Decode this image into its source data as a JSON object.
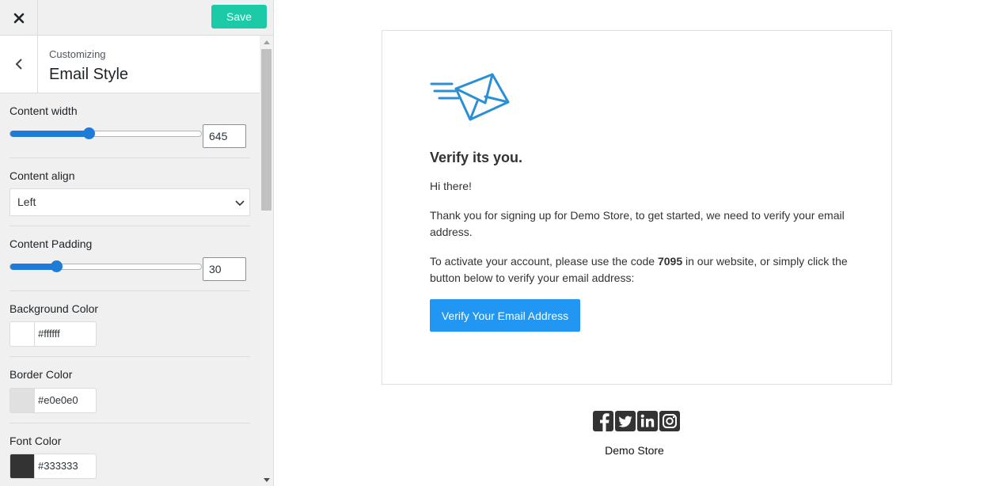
{
  "topbar": {
    "close_icon": "close-icon",
    "save_label": "Save",
    "save_color": "#1ccaa8"
  },
  "section": {
    "crumb": "Customizing",
    "title": "Email Style",
    "back_icon": "chevron-left-icon"
  },
  "controls": {
    "content_width": {
      "label": "Content width",
      "value": "645",
      "fraction": 0.41
    },
    "content_align": {
      "label": "Content align",
      "value": "Left"
    },
    "content_padding": {
      "label": "Content Padding",
      "value": "30",
      "fraction": 0.24
    },
    "background_color": {
      "label": "Background Color",
      "value": "#ffffff"
    },
    "border_color": {
      "label": "Border Color",
      "value": "#e0e0e0"
    },
    "font_color": {
      "label": "Font Color",
      "value": "#333333"
    }
  },
  "email": {
    "icon": "mail-fast-icon",
    "heading": "Verify its you.",
    "greeting": "Hi there!",
    "para1": "Thank you for signing up for Demo Store, to get started, we need to verify your email address.",
    "para2_before": "To activate your account, please use the code ",
    "code": "7095",
    "para2_after": " in our website, or simply click the button below to verify your email address:",
    "button_label": "Verify Your Email Address",
    "button_color": "#2196f3"
  },
  "footer": {
    "social": [
      "facebook-icon",
      "twitter-icon",
      "linkedin-icon",
      "instagram-icon"
    ],
    "store_name": "Demo Store"
  }
}
